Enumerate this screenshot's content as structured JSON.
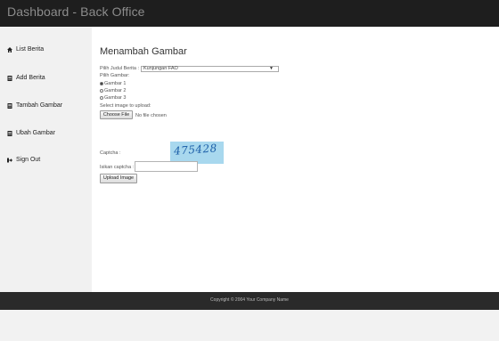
{
  "header": {
    "title": "Dashboard - Back Office"
  },
  "sidebar": {
    "items": [
      {
        "label": "List Berita",
        "icon": "home-icon"
      },
      {
        "label": "Add Berita",
        "icon": "document-icon"
      },
      {
        "label": "Tambah Gambar",
        "icon": "document-icon"
      },
      {
        "label": "Ubah Gambar",
        "icon": "document-icon"
      },
      {
        "label": "Sign Out",
        "icon": "sign-out-icon"
      }
    ]
  },
  "main": {
    "title": "Menambah Gambar",
    "judul_label": "Pilih Judul Berita :",
    "judul_selected": "Kunjungan FAO",
    "gambar_label": "Pilih Gambar:",
    "gambar_options": [
      "Gambar 1",
      "Gambar 2",
      "Gambar 3"
    ],
    "upload_label": "Select image to upload:",
    "choose_file_button": "Choose File",
    "no_file_text": "No file chosen",
    "captcha_label": "Captcha :",
    "captcha_value": "475428",
    "isikan_label": "Isikan captcha :",
    "upload_button": "Upload Image"
  },
  "footer": {
    "text": "Copyright © 2004 Your Company Name"
  }
}
